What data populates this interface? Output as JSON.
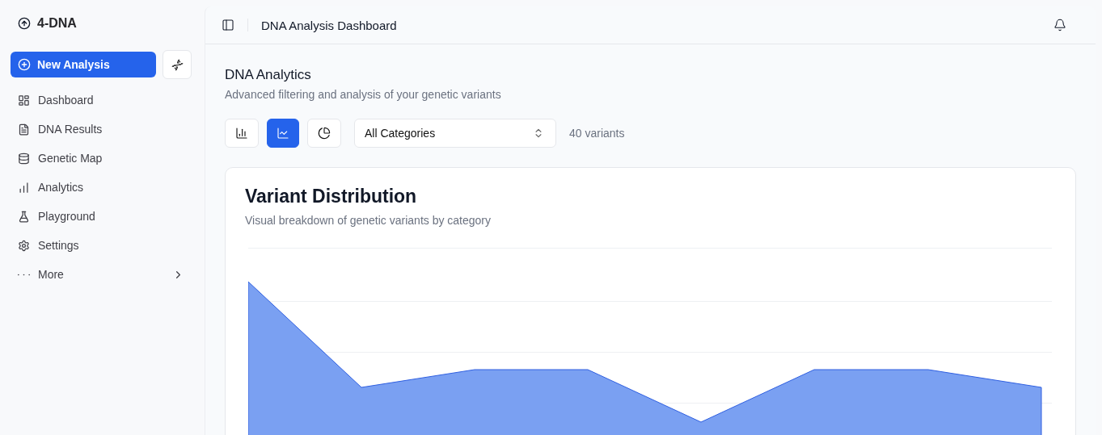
{
  "sidebar": {
    "brand": "4-DNA",
    "new_button": "New Analysis",
    "items": [
      {
        "label": "Dashboard"
      },
      {
        "label": "DNA Results"
      },
      {
        "label": "Genetic Map"
      },
      {
        "label": "Analytics"
      },
      {
        "label": "Playground"
      },
      {
        "label": "Settings"
      },
      {
        "label": "More"
      }
    ]
  },
  "header": {
    "title": "DNA Analysis Dashboard"
  },
  "page": {
    "title": "DNA Analytics",
    "subtitle": "Advanced filtering and analysis of your genetic variants"
  },
  "chart_types": [
    {
      "selected": false
    },
    {
      "selected": true
    },
    {
      "selected": false
    }
  ],
  "category_select": {
    "value": "All Categories"
  },
  "count": "40 variants",
  "card": {
    "title": "Variant Distribution",
    "subtitle": "Visual breakdown of genetic variants by category"
  }
}
